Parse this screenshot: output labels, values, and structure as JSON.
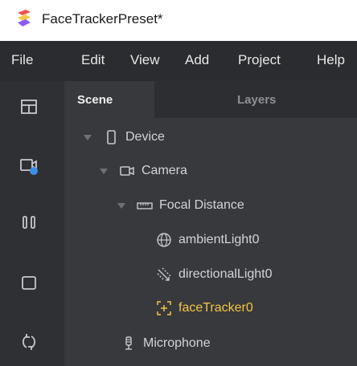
{
  "window": {
    "title": "FaceTrackerPreset*"
  },
  "menu": {
    "items": [
      "File",
      "Edit",
      "View",
      "Add",
      "Project",
      "Help"
    ]
  },
  "toolbar": {
    "buttons": [
      "layout-icon",
      "camera-record-icon",
      "pause-icon",
      "square-icon",
      "refresh-icon"
    ],
    "record_dot_color": "#3b8fe8"
  },
  "tabs": {
    "scene": "Scene",
    "layers": "Layers"
  },
  "tree": {
    "device": "Device",
    "camera": "Camera",
    "focal_distance": "Focal Distance",
    "ambient_light": "ambientLight0",
    "directional_light": "directionalLight0",
    "face_tracker": "faceTracker0",
    "microphone": "Microphone"
  },
  "colors": {
    "selected": "#f5c542",
    "menubar": "#2b2c2f",
    "panel": "#37393c"
  }
}
